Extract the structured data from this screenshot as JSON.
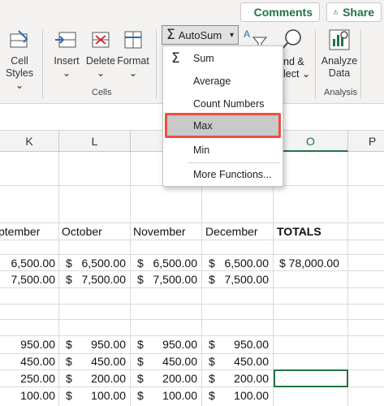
{
  "toolbar": {
    "comments_label": "Comments",
    "share_label": "Share"
  },
  "ribbon": {
    "cell_styles": [
      "Cell",
      "Styles"
    ],
    "insert": "Insert",
    "delete": "Delete",
    "format": "Format",
    "cells_group": "Cells",
    "autosum": "AutoSum",
    "sort_partial": [
      "nd &",
      "lect"
    ],
    "analyze": [
      "Analyze",
      "Data"
    ],
    "analysis_group": "Analysis"
  },
  "autosum_menu": {
    "items": [
      "Sum",
      "Average",
      "Count Numbers",
      "Max",
      "Min",
      "More Functions..."
    ],
    "highlighted": "Max",
    "highlight_color": "#e8513e"
  },
  "sheet": {
    "columns": [
      "K",
      "L",
      "",
      "",
      "O",
      "P"
    ],
    "selected_column": "O",
    "headers": [
      "ptember",
      "October",
      "November",
      "December",
      "TOTALS"
    ],
    "total_value": "$ 78,000.00",
    "rows_group1": [
      [
        "6,500.00",
        "$",
        "6,500.00",
        "$",
        "6,500.00",
        "$",
        "6,500.00"
      ],
      [
        "7,500.00",
        "$",
        "7,500.00",
        "$",
        "7,500.00",
        "$",
        "7,500.00"
      ]
    ],
    "rows_group2": [
      [
        "950.00",
        "$",
        "950.00",
        "$",
        "950.00",
        "$",
        "950.00"
      ],
      [
        "450.00",
        "$",
        "450.00",
        "$",
        "450.00",
        "$",
        "450.00"
      ],
      [
        "250.00",
        "$",
        "200.00",
        "$",
        "200.00",
        "$",
        "200.00"
      ],
      [
        "100.00",
        "$",
        "100.00",
        "$",
        "100.00",
        "$",
        "100.00"
      ]
    ]
  }
}
